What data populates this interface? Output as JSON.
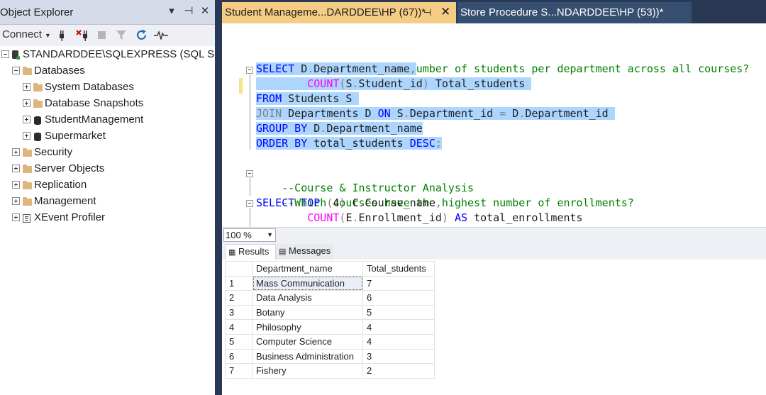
{
  "object_explorer": {
    "title": "Object Explorer",
    "pin_glyph": "▾",
    "dock_glyph": "⊣",
    "close_glyph": "✕",
    "connect_label": "Connect",
    "tree": [
      {
        "label": "STANDARDDEE\\SQLEXPRESS (SQL Server",
        "icon": "server-icon",
        "level": 0,
        "expanded": true
      },
      {
        "label": "Databases",
        "icon": "folder-icon",
        "level": 1,
        "expanded": true
      },
      {
        "label": "System Databases",
        "icon": "folder-icon",
        "level": 2,
        "expanded": false
      },
      {
        "label": "Database Snapshots",
        "icon": "folder-icon",
        "level": 2,
        "expanded": false
      },
      {
        "label": "StudentManagement",
        "icon": "database-icon",
        "level": 2,
        "expanded": false
      },
      {
        "label": "Supermarket",
        "icon": "database-icon",
        "level": 2,
        "expanded": false
      },
      {
        "label": "Security",
        "icon": "folder-icon",
        "level": 1,
        "expanded": false
      },
      {
        "label": "Server Objects",
        "icon": "folder-icon",
        "level": 1,
        "expanded": false
      },
      {
        "label": "Replication",
        "icon": "folder-icon",
        "level": 1,
        "expanded": false
      },
      {
        "label": "Management",
        "icon": "folder-icon",
        "level": 1,
        "expanded": false
      },
      {
        "label": "XEvent Profiler",
        "icon": "xevent-icon",
        "level": 1,
        "expanded": false
      }
    ]
  },
  "tabs": [
    {
      "label": "Student Manageme...DARDDEE\\HP (67))*",
      "active": true,
      "pin": "⊣",
      "close": "✕"
    },
    {
      "label": "Store Procedure S...NDARDDEE\\HP (53))*",
      "active": false
    }
  ],
  "editor": {
    "lines": [
      {
        "text": "--What is the total number of students per department across all courses?"
      },
      {
        "text": "SELECT D.Department_name,"
      },
      {
        "text": "COUNT(S.Student_id) Total_students"
      },
      {
        "text": "FROM Students S"
      },
      {
        "text": "JOIN Departments D ON S.Department_id = D.Department_id"
      },
      {
        "text": "GROUP BY D.Department_name"
      },
      {
        "text": "ORDER BY total_students DESC;"
      },
      {
        "text": "--Course & Instructor Analysis"
      },
      {
        "text": "--Which courses have the highest number of enrollments?"
      },
      {
        "text": "SELECT TOP (4) C.Course_name,"
      },
      {
        "text": "COUNT(E.Enrollment_id) AS total_enrollments"
      }
    ],
    "tokens": {
      "l0": [
        "--What is the total number of students per department across all courses?"
      ],
      "l1": [
        "SELECT",
        " D",
        ".",
        "Department_name",
        ","
      ],
      "l2": [
        "        ",
        "COUNT",
        "(",
        "S",
        ".",
        "Student_id",
        ")",
        " Total_students "
      ],
      "l3": [
        "FROM",
        " Students S "
      ],
      "l4": [
        "JOIN",
        " Departments D ",
        "ON",
        " S",
        ".",
        "Department_id ",
        "=",
        " D",
        ".",
        "Department_id "
      ],
      "l5": [
        "GROUP BY",
        " D",
        ".",
        "Department_name"
      ],
      "l6": [
        "ORDER BY",
        " total_students ",
        "DESC",
        ";"
      ],
      "l7": [
        "--Course & Instructor Analysis"
      ],
      "l8": [
        "--Which courses have the highest number of enrollments?"
      ],
      "l9": [
        "SELECT TOP",
        " ",
        "(",
        "4",
        ")",
        " C",
        ".",
        "Course_name",
        ","
      ],
      "l10": [
        "        ",
        "COUNT",
        "(",
        "E",
        ".",
        "Enrollment_id",
        ")",
        " ",
        "AS",
        " total_enrollments"
      ]
    }
  },
  "zoom": "100 %",
  "results_tabs": {
    "results": "Results",
    "messages": "Messages"
  },
  "grid": {
    "headers": [
      "Department_name",
      "Total_students"
    ],
    "rows": [
      {
        "n": "1",
        "department": "Mass Communication",
        "total": "7"
      },
      {
        "n": "2",
        "department": "Data Analysis",
        "total": "6"
      },
      {
        "n": "3",
        "department": "Botany",
        "total": "5"
      },
      {
        "n": "4",
        "department": "Philosophy",
        "total": "4"
      },
      {
        "n": "5",
        "department": "Computer Science",
        "total": "4"
      },
      {
        "n": "6",
        "department": "Business Administration",
        "total": "3"
      },
      {
        "n": "7",
        "department": "Fishery",
        "total": "2"
      }
    ]
  },
  "colors": {
    "title_bar": "#d6dbe9",
    "dark_frame": "#293955",
    "active_tab": "#f5cc84",
    "selection": "#add6ff",
    "keyword": "#0000ff",
    "function": "#ff00ff",
    "comment": "#008000"
  }
}
